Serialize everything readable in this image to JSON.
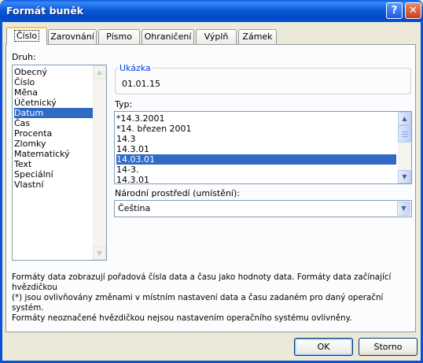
{
  "window": {
    "title": "Formát buněk",
    "help_label": "?",
    "close_label": "✕"
  },
  "tabs": [
    {
      "label": "Číslo",
      "active": true
    },
    {
      "label": "Zarovnání",
      "active": false
    },
    {
      "label": "Písmo",
      "active": false
    },
    {
      "label": "Ohraničení",
      "active": false
    },
    {
      "label": "Výplň",
      "active": false
    },
    {
      "label": "Zámek",
      "active": false
    }
  ],
  "category": {
    "label": "Druh:",
    "items": [
      "Obecný",
      "Číslo",
      "Měna",
      "Účetnický",
      "Datum",
      "Čas",
      "Procenta",
      "Zlomky",
      "Matematický",
      "Text",
      "Speciální",
      "Vlastní"
    ],
    "selected": "Datum"
  },
  "sample": {
    "label": "Ukázka",
    "value": "01.01.15"
  },
  "type": {
    "label": "Typ:",
    "items": [
      "*14.3.2001",
      "*14. březen 2001",
      "14.3",
      "14.3.01",
      "14.03.01",
      "14-3.",
      "14.3.01"
    ],
    "selected": "14.03.01"
  },
  "locale": {
    "label": "Národní prostředí (umístění):",
    "value": "Čeština"
  },
  "description": {
    "line1": "Formáty data zobrazují pořadová čísla data a času jako hodnoty data. Formáty data začínající hvězdičkou",
    "line2": "(*) jsou ovlivňovány změnami v místním nastavení data a času zadaném pro daný operační systém.",
    "line3": "Formáty neoznačené hvězdičkou nejsou nastavením operačního systému ovlivněny."
  },
  "buttons": {
    "ok": "OK",
    "cancel": "Storno"
  },
  "icons": {
    "scroll_up": "▲",
    "scroll_down": "▼",
    "dropdown": "▼"
  },
  "colors": {
    "titlebar": "#0b5ad8",
    "selection": "#316ac5",
    "group_title": "#0046d5",
    "active_tab_accent": "#ffc83c"
  }
}
